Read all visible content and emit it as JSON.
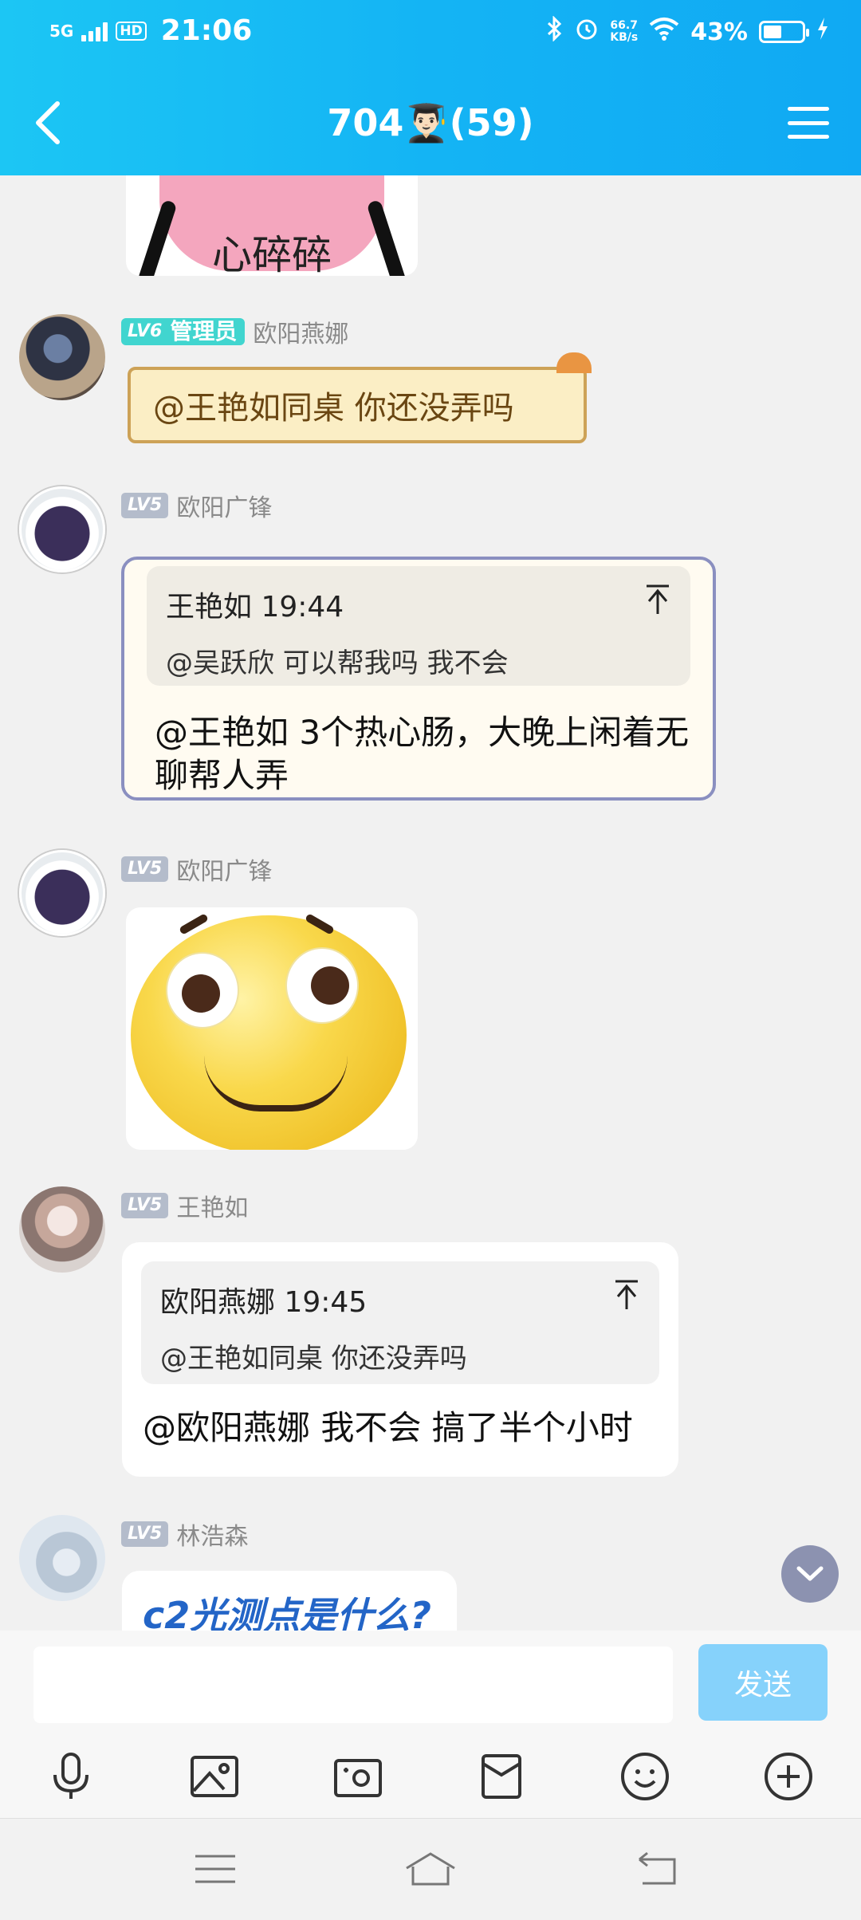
{
  "status_bar": {
    "network": "5G",
    "hd": "HD",
    "time": "21:06",
    "speed_value": "66.7",
    "speed_unit": "KB/s",
    "battery": "43%"
  },
  "header": {
    "title": "704👨🏻‍🎓(59)"
  },
  "messages": {
    "sticker_top_text": "心碎碎",
    "m1": {
      "level": "LV6",
      "role": "管理员",
      "sender": "欧阳燕娜",
      "text": "@王艳如同桌 你还没弄吗"
    },
    "m2": {
      "level": "LV5",
      "sender": "欧阳广锋",
      "quote_head": "王艳如 19:44",
      "quote_body": "@吴跃欣 可以帮我吗 我不会",
      "text": "@王艳如 3个热心肠，大晚上闲着无聊帮人弄"
    },
    "m3": {
      "level": "LV5",
      "sender": "欧阳广锋"
    },
    "m4": {
      "level": "LV5",
      "sender": "王艳如",
      "quote_head": "欧阳燕娜 19:45",
      "quote_body": "@王艳如同桌 你还没弄吗",
      "text": "@欧阳燕娜 我不会 搞了半个小时"
    },
    "m5": {
      "level": "LV5",
      "sender": "林浩森",
      "text": "c2光测点是什么?"
    }
  },
  "input": {
    "placeholder": "",
    "send_label": "发送"
  },
  "icons": [
    "back-icon",
    "menu-icon",
    "microphone-icon",
    "image-icon",
    "camera-icon",
    "red-packet-icon",
    "emoji-icon",
    "plus-icon",
    "chevron-down-icon",
    "system-menu-icon",
    "system-home-icon",
    "system-back-icon"
  ],
  "colors": {
    "header_start": "#1cc6f4",
    "header_end": "#10a9f3",
    "send_button": "#86d2fb",
    "admin_badge": "#41d5cf",
    "blue_text": "#2365c7"
  }
}
